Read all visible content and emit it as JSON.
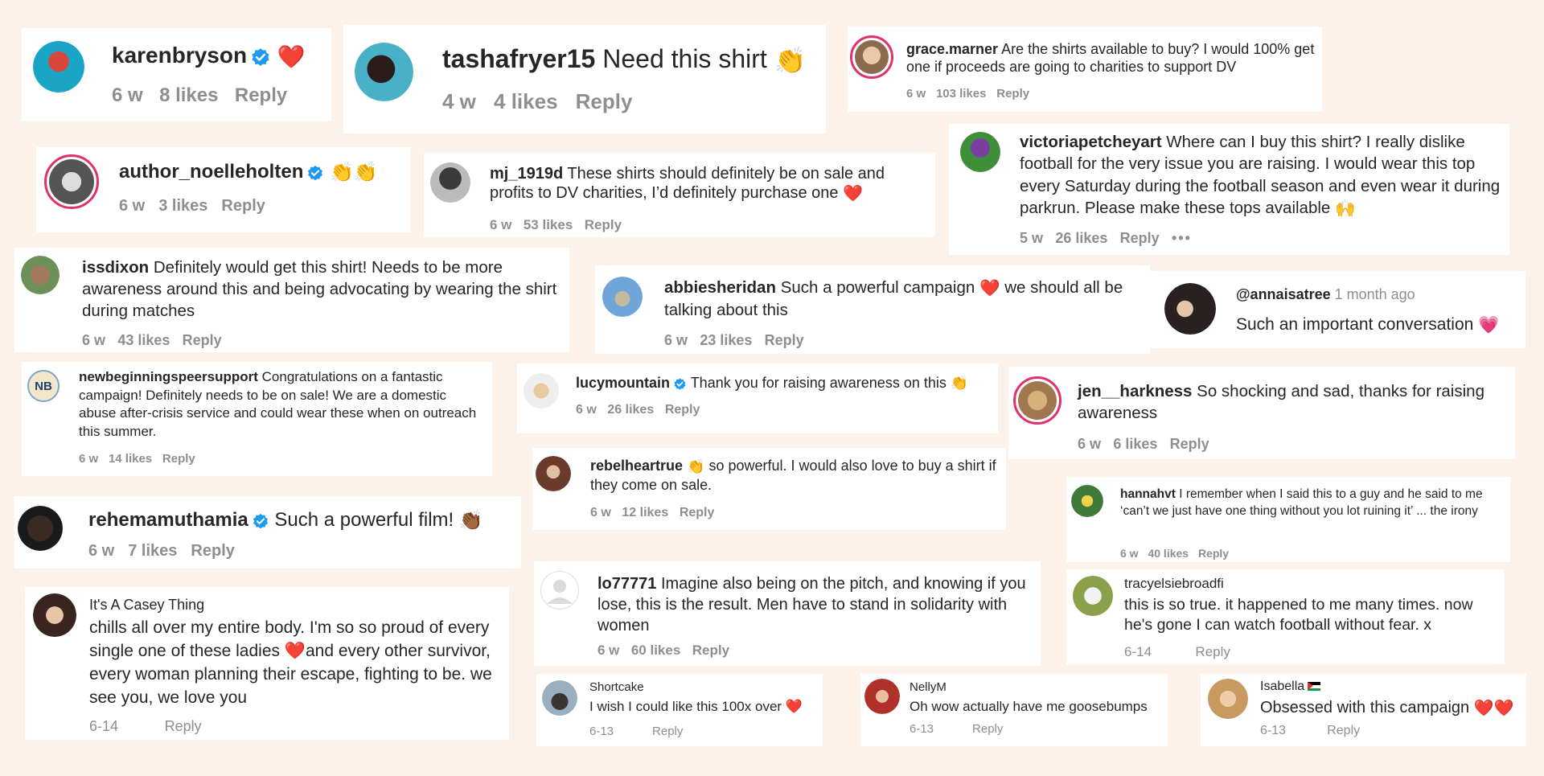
{
  "comments": {
    "karenbryson": {
      "user": "karenbryson",
      "emoji": "❤️",
      "time": "6 w",
      "likes": "8 likes",
      "reply": "Reply"
    },
    "tashafryer15": {
      "user": "tashafryer15",
      "text": " Need this shirt ",
      "emoji": "👏",
      "time": "4 w",
      "likes": "4 likes",
      "reply": "Reply"
    },
    "grace": {
      "user": "grace.marner",
      "text": " Are the shirts available to buy? I would 100% get one if proceeds are going to charities to support DV",
      "time": "6 w",
      "likes": "103 likes",
      "reply": "Reply"
    },
    "noelle": {
      "user": "author_noelleholten",
      "emoji": "👏👏",
      "time": "6 w",
      "likes": "3 likes",
      "reply": "Reply"
    },
    "mj": {
      "user": "mj_1919d",
      "text": " These shirts should definitely be on sale and profits to DV charities, I’d definitely purchase one ",
      "emoji": "❤️",
      "time": "6 w",
      "likes": "53 likes",
      "reply": "Reply"
    },
    "victoria": {
      "user": "victoriapetcheyart",
      "text": " Where can I buy this shirt? I really dislike football for the very issue you are raising. I would wear this top every Saturday during the football season and even wear it during parkrun. Please make these tops available ",
      "emoji": "🙌",
      "time": "5 w",
      "likes": "26 likes",
      "reply": "Reply",
      "more": "•••"
    },
    "issdixon": {
      "user": "issdixon",
      "text": " Definitely would get this shirt! Needs to be more awareness around this and being advocating by wearing the shirt during matches",
      "time": "6 w",
      "likes": "43 likes",
      "reply": "Reply"
    },
    "abbie": {
      "user": "abbiesheridan",
      "text1": " Such a powerful campaign ",
      "emoji": "❤️",
      "text2": " we should all be talking about this",
      "time": "6 w",
      "likes": "23 likes",
      "reply": "Reply"
    },
    "annaisatree": {
      "user": "@annaisatree",
      "time": "1 month ago",
      "text": "Such an important conversation ",
      "emoji": "💗"
    },
    "newbeginnings": {
      "user": "newbeginningspeersupport",
      "logo": "NB",
      "text": " Congratulations on a fantastic campaign! Definitely needs to be on sale! We are a domestic abuse after-crisis service and could wear these when on outreach this summer.",
      "time": "6 w",
      "likes": "14 likes",
      "reply": "Reply"
    },
    "lucy": {
      "user": "lucymountain",
      "text": " Thank you for raising awareness on this ",
      "emoji": "👏",
      "time": "6 w",
      "likes": "26 likes",
      "reply": "Reply"
    },
    "jen": {
      "user": "jen__harkness",
      "text": " So shocking and sad, thanks for raising awareness",
      "time": "6 w",
      "likes": "6 likes",
      "reply": "Reply"
    },
    "rebel": {
      "user": "rebelheartrue",
      "emoji": "👏",
      "text": " so powerful. I would also love to buy a shirt if they come on sale.",
      "time": "6 w",
      "likes": "12 likes",
      "reply": "Reply"
    },
    "hanna": {
      "user": "hannahvt",
      "text": " I remember when I said this to a guy and he said to me ‘can’t we just have one thing without you lot ruining it’ ... the irony",
      "time": "6 w",
      "likes": "40 likes",
      "reply": "Reply"
    },
    "rehema": {
      "user": "rehemamuthamia",
      "text": " Such a powerful film! ",
      "emoji": "👏🏾",
      "time": "6 w",
      "likes": "7 likes",
      "reply": "Reply"
    },
    "casey": {
      "user": "It's A Casey Thing",
      "text1": "chills all over my entire body. I'm so so proud of every single one of these ladies ",
      "emoji": "❤️",
      "text2": "and every other survivor, every woman planning their escape, fighting to be. we see you, we love you",
      "time": "6-14",
      "reply": "Reply"
    },
    "lo77771": {
      "user": "lo77771",
      "text": " Imagine also being on the pitch, and knowing if you lose, this is the result. Men have to stand in solidarity with women",
      "time": "6 w",
      "likes": "60 likes",
      "reply": "Reply"
    },
    "tracy": {
      "user": "tracyelsiebroadfi",
      "text": "this is so true. it happened to me many times. now he's gone I can watch football without fear. x",
      "time": "6-14",
      "reply": "Reply"
    },
    "shortcake": {
      "user": "Shortcake",
      "text": "I wish I could like this 100x over ",
      "emoji": "❤️",
      "time": "6-13",
      "reply": "Reply"
    },
    "nelly": {
      "user": "NellyM",
      "text": "Oh wow actually have me goosebumps",
      "time": "6-13",
      "reply": "Reply"
    },
    "isabella": {
      "user": "Isabella",
      "text": "Obsessed with this campaign ",
      "emoji": "❤️❤️",
      "time": "6-13",
      "reply": "Reply"
    }
  },
  "colors": {
    "background": "#fdf2ea",
    "card": "#ffffff",
    "text": "#262626",
    "meta": "#8e8e8e",
    "verified": "#1d9bf0",
    "heart": "#e0202b",
    "ring": "#e1306c"
  }
}
